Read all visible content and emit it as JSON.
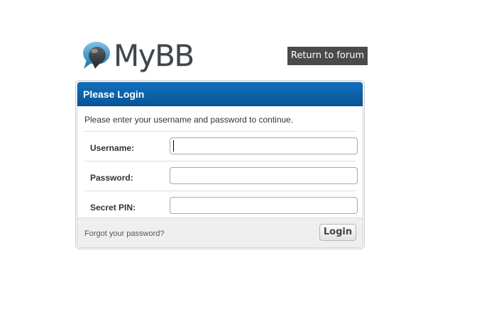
{
  "header": {
    "logo_text": "MyBB",
    "return_label": "Return to forum"
  },
  "login": {
    "title": "Please Login",
    "intro": "Please enter your username and password to continue.",
    "fields": [
      {
        "label": "Username:",
        "value": ""
      },
      {
        "label": "Password:",
        "value": ""
      },
      {
        "label": "Secret PIN:",
        "value": ""
      }
    ],
    "forgot_label": "Forgot your password?",
    "submit_label": "Login"
  },
  "colors": {
    "header_blue": "#0a5596",
    "return_button_bg": "#4a4a4a",
    "footer_bg": "#efefef"
  },
  "icons": {
    "logo": "speech-bubbles-icon"
  }
}
